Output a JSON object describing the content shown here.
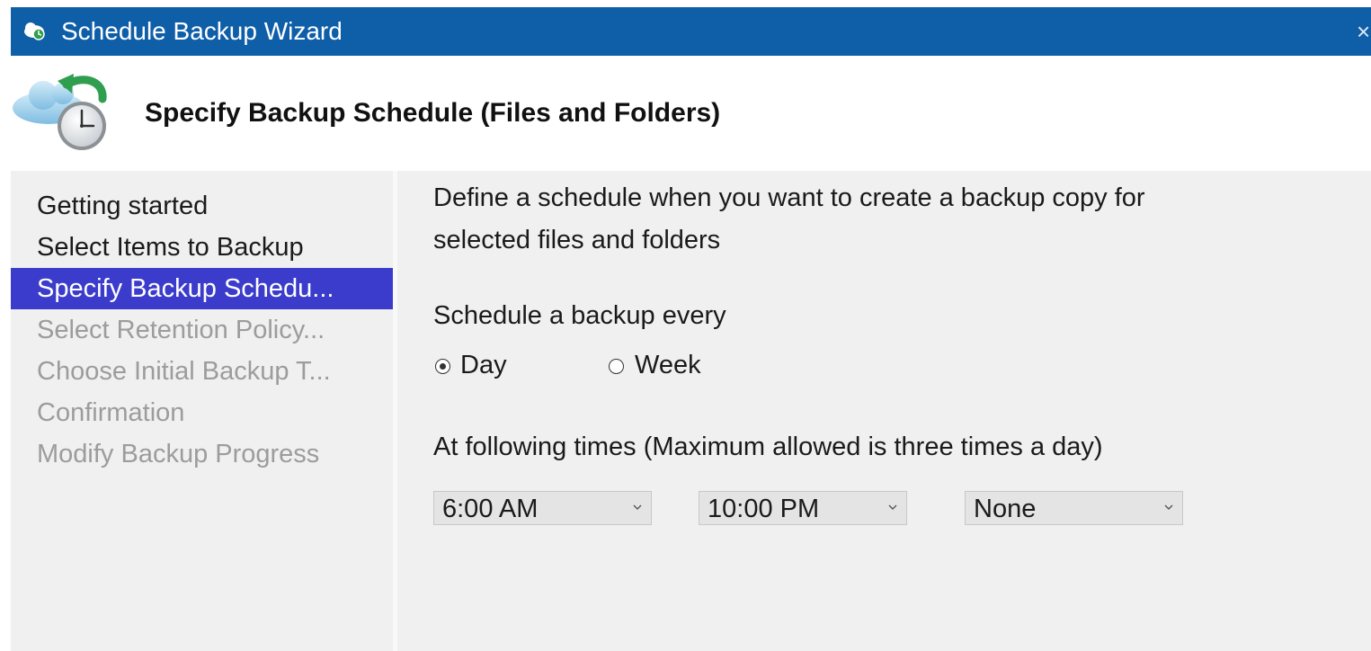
{
  "window": {
    "title": "Schedule Backup Wizard",
    "close_label": "×",
    "colors": {
      "titlebar": "#0e5ea8",
      "selected_step": "#3b3ccc",
      "panel": "#f0f0f0",
      "disabled_text": "#9c9c9c"
    }
  },
  "header": {
    "title": "Specify Backup Schedule (Files and Folders)",
    "icon": "cloud-clock-icon"
  },
  "steps": [
    {
      "label": "Getting started",
      "state": "done"
    },
    {
      "label": "Select Items to Backup",
      "state": "done"
    },
    {
      "label": "Specify Backup Schedu...",
      "state": "current"
    },
    {
      "label": "Select Retention Policy...",
      "state": "pending"
    },
    {
      "label": "Choose Initial Backup T...",
      "state": "pending"
    },
    {
      "label": "Confirmation",
      "state": "pending"
    },
    {
      "label": "Modify Backup Progress",
      "state": "pending"
    }
  ],
  "content": {
    "description_line1": "Define a schedule when you want to create a backup copy for",
    "description_line2": "selected files and folders",
    "frequency_label": "Schedule a backup every",
    "frequency_options": [
      {
        "label": "Day",
        "selected": true
      },
      {
        "label": "Week",
        "selected": false
      }
    ],
    "times_label": "At following times (Maximum allowed is three times a day)",
    "times": [
      "6:00 AM",
      "10:00 PM",
      "None"
    ]
  }
}
